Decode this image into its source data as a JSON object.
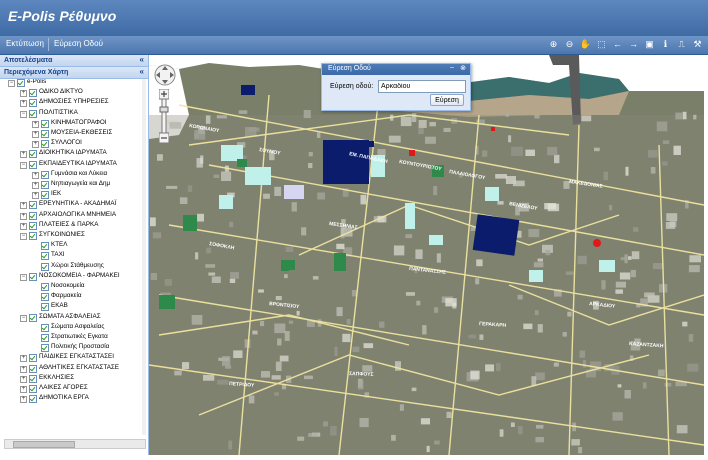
{
  "app": {
    "title": "E-Polis Ρέθυμνο"
  },
  "menu": [
    {
      "label": "Εκτύπωση"
    },
    {
      "label": "Εύρεση Οδού"
    }
  ],
  "map_tools": [
    {
      "icon": "zoom-in-icon",
      "glyph": "⊕"
    },
    {
      "icon": "zoom-out-icon",
      "glyph": "⊖"
    },
    {
      "icon": "pan-hand-icon",
      "glyph": "✋"
    },
    {
      "icon": "zoom-box-icon",
      "glyph": "⬚"
    },
    {
      "icon": "arrow-left-icon",
      "glyph": "←"
    },
    {
      "icon": "arrow-right-icon",
      "glyph": "→"
    },
    {
      "icon": "full-extent-icon",
      "glyph": "▣"
    },
    {
      "icon": "info-icon",
      "glyph": "ℹ"
    },
    {
      "icon": "measure-icon",
      "glyph": "⎍"
    },
    {
      "icon": "tools-icon",
      "glyph": "⚒"
    }
  ],
  "panels": {
    "results": {
      "title": "Αποτελέσματα",
      "collapse": "«"
    },
    "layers": {
      "title": "Περιεχόμενα Χάρτη",
      "collapse": "«"
    }
  },
  "tree": [
    {
      "level": 0,
      "label": "e-Polis",
      "exp": "−"
    },
    {
      "level": 1,
      "label": "ΟΔΙΚΟ ΔΙΚΤΥΟ",
      "exp": "+"
    },
    {
      "level": 1,
      "label": "ΔΗΜΟΣΙΕΣ ΥΠΗΡΕΣΙΕΣ",
      "exp": "+"
    },
    {
      "level": 1,
      "label": "ΠΟΛΙΤΙΣΤΙΚΑ",
      "exp": "−"
    },
    {
      "level": 2,
      "label": "ΚΙΝΗΜΑΤΟΓΡΑΦΟΙ",
      "exp": "+"
    },
    {
      "level": 2,
      "label": "ΜΟΥΣΕΙΑ-ΕΚΘΕΣΕΙΣ",
      "exp": "+"
    },
    {
      "level": 2,
      "label": "ΣΥΛΛΟΓΟΙ",
      "exp": "+"
    },
    {
      "level": 1,
      "label": "ΔΙΟΙΚΗΤΙΚΑ ΙΔΡΥΜΑΤΑ",
      "exp": "+"
    },
    {
      "level": 1,
      "label": "ΕΚΠΑΙΔΕΥΤΙΚΑ ΙΔΡΥΜΑΤΑ",
      "exp": "−"
    },
    {
      "level": 2,
      "label": "Γυμνάσια και Λύκεια",
      "exp": "+"
    },
    {
      "level": 2,
      "label": "Νηπιαγωγεία και Δημ",
      "exp": "+"
    },
    {
      "level": 2,
      "label": "ΙΕΚ",
      "exp": "+"
    },
    {
      "level": 1,
      "label": "ΕΡΕΥΝΗΤΙΚΑ - ΑΚΑΔΗΜΑΪ",
      "exp": "+"
    },
    {
      "level": 1,
      "label": "ΑΡΧΑΙΟΛΟΓΙΚΑ ΜΝΗΜΕΙΑ",
      "exp": "+"
    },
    {
      "level": 1,
      "label": "ΠΛΑΤΕΙΕΣ & ΠΑΡΚΑ",
      "exp": "+"
    },
    {
      "level": 1,
      "label": "ΣΥΓΚΟΙΝΩΝΙΕΣ",
      "exp": "−"
    },
    {
      "level": 2,
      "label": "ΚΤΕΛ",
      "exp": ""
    },
    {
      "level": 2,
      "label": "TAXI",
      "exp": ""
    },
    {
      "level": 2,
      "label": "Χώροι Στάθμευσης",
      "exp": ""
    },
    {
      "level": 1,
      "label": "ΝΟΣΟΚΟΜΕΙΑ - ΦΑΡΜΑΚΕΙ",
      "exp": "−"
    },
    {
      "level": 2,
      "label": "Νοσοκομεία",
      "exp": ""
    },
    {
      "level": 2,
      "label": "Φαρμακεία",
      "exp": ""
    },
    {
      "level": 2,
      "label": "ΕΚΑΒ",
      "exp": ""
    },
    {
      "level": 1,
      "label": "ΣΩΜΑΤΑ ΑΣΦΑΛΕΙΑΣ",
      "exp": "−"
    },
    {
      "level": 2,
      "label": "Σώματα Ασφαλείας",
      "exp": ""
    },
    {
      "level": 2,
      "label": "Στρατιωτικές Εγκατα",
      "exp": ""
    },
    {
      "level": 2,
      "label": "Πολιτικής Προστασία",
      "exp": ""
    },
    {
      "level": 1,
      "label": "ΠΑΙΔΙΚΕΣ ΕΓΚΑΤΑΣΤΑΣΕΙ",
      "exp": "+"
    },
    {
      "level": 1,
      "label": "ΑΘΛΗΤΙΚΕΣ ΕΓΚΑΤΑΣΤΑΣΕ",
      "exp": "+"
    },
    {
      "level": 1,
      "label": "ΕΚΚΛΗΣΙΕΣ",
      "exp": "+"
    },
    {
      "level": 1,
      "label": "ΛΑΙΚΕΣ ΑΓΟΡΕΣ",
      "exp": "+"
    },
    {
      "level": 1,
      "label": "ΔΗΜΟΤΙΚΑ ΕΡΓΑ",
      "exp": "+"
    }
  ],
  "finder": {
    "title": "Εύρεση Οδού",
    "minimize": "–",
    "close": "⊗",
    "label": "Εύρεση οδού:",
    "value": "Αρκαδίου",
    "button": "Εύρεση"
  },
  "map_labels": [
    "ΚΟΡΩΝΑΙΟΥ",
    "ΣΟΥΛΙΟΥ",
    "ΕΜ. ΠΑΠΑΔΑΚΗ",
    "ΠΑΛΑΙΟΛΟΓΟΥ",
    "ΚΟΥΝΤΟΥΡΙΩΤΟΥ",
    "ΜΑΚΕΔΟΝΙΑΣ",
    "ΒΕΝΙΖΕΛΟΥ",
    "ΜΕΣΣΗΝΙΑΣ",
    "ΣΟΦΟΚΛΗ",
    "ΠΑΝΤΑΝΑΣΣΗΣ",
    "ΑΡΚΑΔΙΟΥ",
    "ΒΡΟΝΤΙΣΙΟΥ",
    "ΓΕΡΑΚΑΡΗ",
    "ΚΑΖΑΝΤΖΑΚΗ",
    "ΣΑΠΦΟΥΣ",
    "ΠΕΤΡΙΔΟΥ"
  ]
}
